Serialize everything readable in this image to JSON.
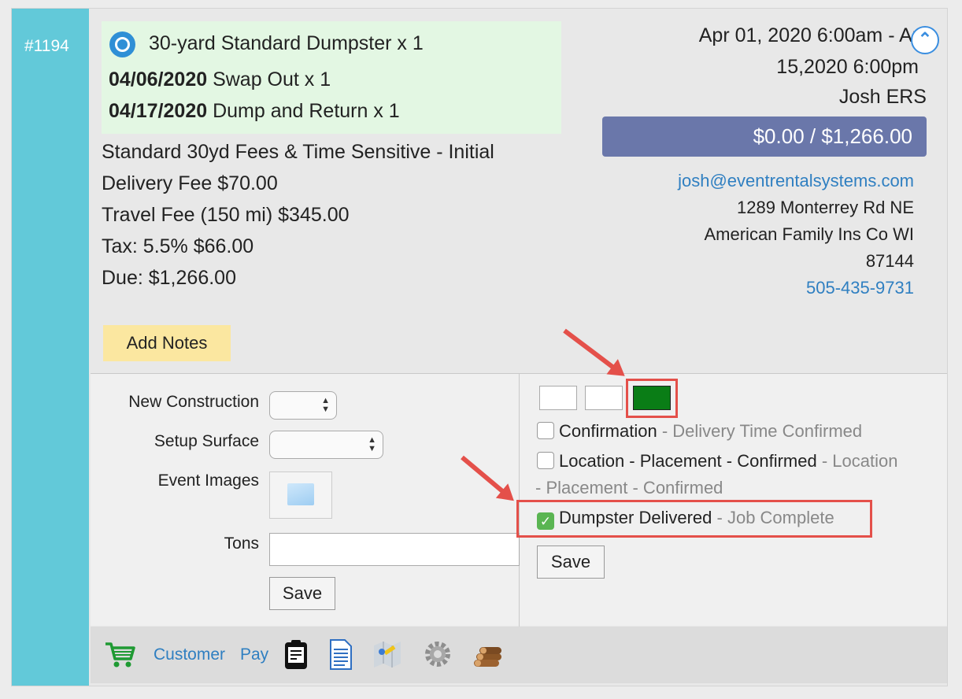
{
  "order": {
    "number": "#1194",
    "items": [
      {
        "date": "",
        "text": "30-yard Standard Dumpster x 1",
        "icon": "dumpster-icon"
      },
      {
        "date": "04/06/2020",
        "text": "Swap Out x 1"
      },
      {
        "date": "04/17/2020",
        "text": "Dump and Return x 1"
      }
    ],
    "fees": [
      "Standard 30yd Fees & Time Sensitive - Initial",
      "Delivery Fee $70.00",
      "Travel Fee (150 mi) $345.00",
      "Tax: 5.5% $66.00",
      "Due: $1,266.00"
    ],
    "date_range_line1": "Apr 01, 2020 6:00am - Apr",
    "date_range_line2": "15,2020 6:00pm",
    "owner": "Josh ERS",
    "balance": "$0.00 / $1,266.00",
    "email": "josh@eventrentalsystems.com",
    "address1": "1289 Monterrey Rd NE",
    "address2": "American Family Ins Co WI",
    "zip": "87144",
    "phone": "505-435-9731",
    "add_notes_label": "Add Notes"
  },
  "custom_fields": {
    "new_construction_label": "New Construction",
    "setup_surface_label": "Setup Surface",
    "event_images_label": "Event Images",
    "tons_label": "Tons",
    "tons_value": "",
    "save_label": "Save"
  },
  "status": {
    "swatch_colors": [
      "#ffffff",
      "#ffffff",
      "#0a7d16"
    ],
    "checklist": [
      {
        "label": "Confirmation",
        "detail": " - Delivery Time Confirmed",
        "checked": false
      },
      {
        "label": "Location - Placement - Confirmed",
        "detail": " - Location",
        "detail2": "- Placement - Confirmed",
        "checked": false
      },
      {
        "label": "Dumpster Delivered",
        "detail": " - Job Complete",
        "checked": true
      }
    ],
    "save_label": "Save"
  },
  "footer": {
    "customer_label": "Customer",
    "pay_label": "Pay",
    "icons": [
      "cart-icon",
      "clipboard-icon",
      "document-icon",
      "map-icon",
      "gear-icon",
      "logs-icon"
    ]
  },
  "accent_colors": {
    "id_bar": "#62c9d9",
    "balance": "#6a77aa",
    "notes": "#fbe7a0",
    "highlight": "#e4504a",
    "link": "#2f7fc1"
  }
}
